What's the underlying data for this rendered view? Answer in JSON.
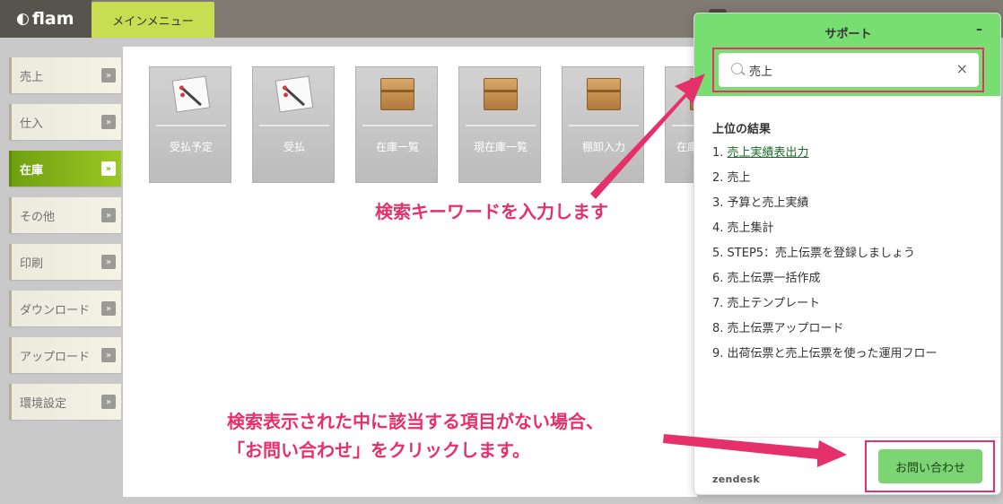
{
  "header": {
    "logo_text": "flam",
    "main_tab": "メインメニュー"
  },
  "sidebar": {
    "items": [
      {
        "label": "売上",
        "arrow": "»",
        "active": false
      },
      {
        "label": "仕入",
        "arrow": "»",
        "active": false
      },
      {
        "label": "在庫",
        "arrow": "»",
        "active": true
      },
      {
        "label": "その他",
        "arrow": "»",
        "active": false
      },
      {
        "label": "印刷",
        "arrow": "»",
        "active": false
      },
      {
        "label": "ダウンロード",
        "arrow": "»",
        "active": false
      },
      {
        "label": "アップロード",
        "arrow": "»",
        "active": false
      },
      {
        "label": "環境設定",
        "arrow": "»",
        "active": false
      }
    ]
  },
  "tiles": [
    {
      "label": "受払予定",
      "icon": "document-pen-icon"
    },
    {
      "label": "受払",
      "icon": "document-pen-icon"
    },
    {
      "label": "在庫一覧",
      "icon": "box-icon"
    },
    {
      "label": "現在庫一覧",
      "icon": "box-icon"
    },
    {
      "label": "棚卸入力",
      "icon": "box-icon"
    },
    {
      "label": "在庫",
      "icon": "box-icon"
    }
  ],
  "support": {
    "title": "サポート",
    "minimize": "–",
    "search_value": "売上",
    "clear": "×",
    "results_heading": "上位の結果",
    "results": [
      "1. 売上実績表出力",
      "2. 売上",
      "3. 予算と売上実績",
      "4. 売上集計",
      "5. STEP5：売上伝票を登録しましょう",
      "6. 売上伝票一括作成",
      "7. 売上テンプレート",
      "8. 売上伝票アップロード",
      "9. 出荷伝票と売上伝票を使った運用フロー"
    ],
    "footer_brand": "zendesk",
    "contact_button": "お問い合わせ"
  },
  "annotations": {
    "search_hint": "検索キーワードを入力します",
    "contact_hint_line1": "検索表示された中に該当する項目がない場合、",
    "contact_hint_line2": "「お問い合わせ」をクリックします。"
  },
  "colors": {
    "accent_green": "#79de72",
    "highlight_pink": "#e6306b",
    "active_menu": "#7aae18"
  }
}
